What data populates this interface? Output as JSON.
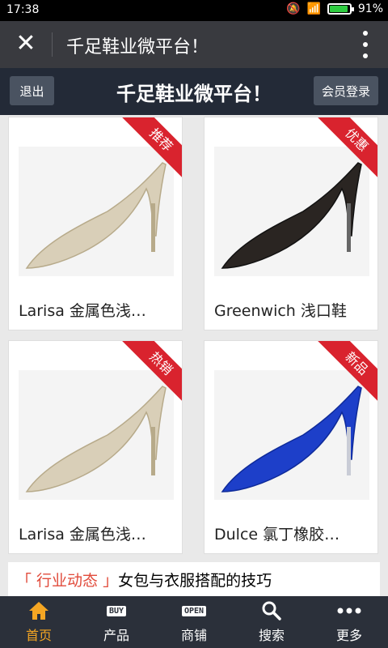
{
  "status": {
    "time": "17:38",
    "battery": "91%"
  },
  "wechat": {
    "title": "千足鞋业微平台！"
  },
  "header": {
    "logout_label": "退出",
    "title": "千足鞋业微平台！",
    "login_label": "会员登录"
  },
  "products": [
    {
      "name": "Larisa 金属色浅…",
      "badge": "推荐",
      "color": "#d9cfb8"
    },
    {
      "name": "Greenwich 浅口鞋",
      "badge": "优惠",
      "color": "#2a2522"
    },
    {
      "name": "Larisa 金属色浅…",
      "badge": "热销",
      "color": "#d9cfb8"
    },
    {
      "name": "Dulce 氯丁橡胶…",
      "badge": "新品",
      "color": "#1d3fc9"
    }
  ],
  "news": {
    "tag": "行业动态",
    "title": "女包与衣服搭配的技巧"
  },
  "tabs": [
    {
      "label": "首页",
      "icon": "home-icon"
    },
    {
      "label": "产品",
      "icon": "buy-icon",
      "chip": "BUY"
    },
    {
      "label": "商铺",
      "icon": "open-sign-icon",
      "chip": "OPEN"
    },
    {
      "label": "搜索",
      "icon": "search-icon"
    },
    {
      "label": "更多",
      "icon": "more-icon"
    }
  ],
  "colors": {
    "accent": "#f5a623",
    "badge": "#d9232e",
    "tag": "#e14b3b"
  }
}
